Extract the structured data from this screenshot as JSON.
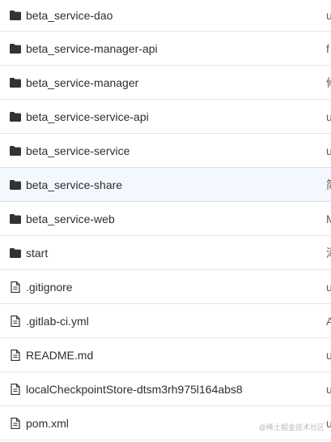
{
  "files": [
    {
      "name": "beta_service-dao",
      "type": "folder",
      "icon": "folder-icon",
      "commit": "u"
    },
    {
      "name": "beta_service-manager-api",
      "type": "folder",
      "icon": "folder-icon",
      "commit": "f"
    },
    {
      "name": "beta_service-manager",
      "type": "folder",
      "icon": "folder-icon",
      "commit": "修"
    },
    {
      "name": "beta_service-service-api",
      "type": "folder",
      "icon": "folder-icon",
      "commit": "u"
    },
    {
      "name": "beta_service-service",
      "type": "folder",
      "icon": "folder-icon",
      "commit": "u"
    },
    {
      "name": "beta_service-share",
      "type": "folder",
      "icon": "folder-icon",
      "commit": "简"
    },
    {
      "name": "beta_service-web",
      "type": "folder",
      "icon": "folder-icon",
      "commit": "M"
    },
    {
      "name": "start",
      "type": "folder",
      "icon": "folder-icon",
      "commit": "添"
    },
    {
      "name": ".gitignore",
      "type": "file",
      "icon": "file-icon",
      "commit": "u"
    },
    {
      "name": ".gitlab-ci.yml",
      "type": "file",
      "icon": "file-icon",
      "commit": "A"
    },
    {
      "name": "README.md",
      "type": "file",
      "icon": "file-icon",
      "commit": "u"
    },
    {
      "name": "localCheckpointStore-dtsm3rh975l164abs8",
      "type": "file",
      "icon": "file-icon",
      "commit": "u"
    },
    {
      "name": "pom.xml",
      "type": "file",
      "icon": "file-icon",
      "commit": "u"
    }
  ],
  "watermark": "@稀土掘金技术社区",
  "colors": {
    "hover_row_background": "#f2f8fd",
    "row_border": "#e4e6e9",
    "icon": "#333333"
  }
}
